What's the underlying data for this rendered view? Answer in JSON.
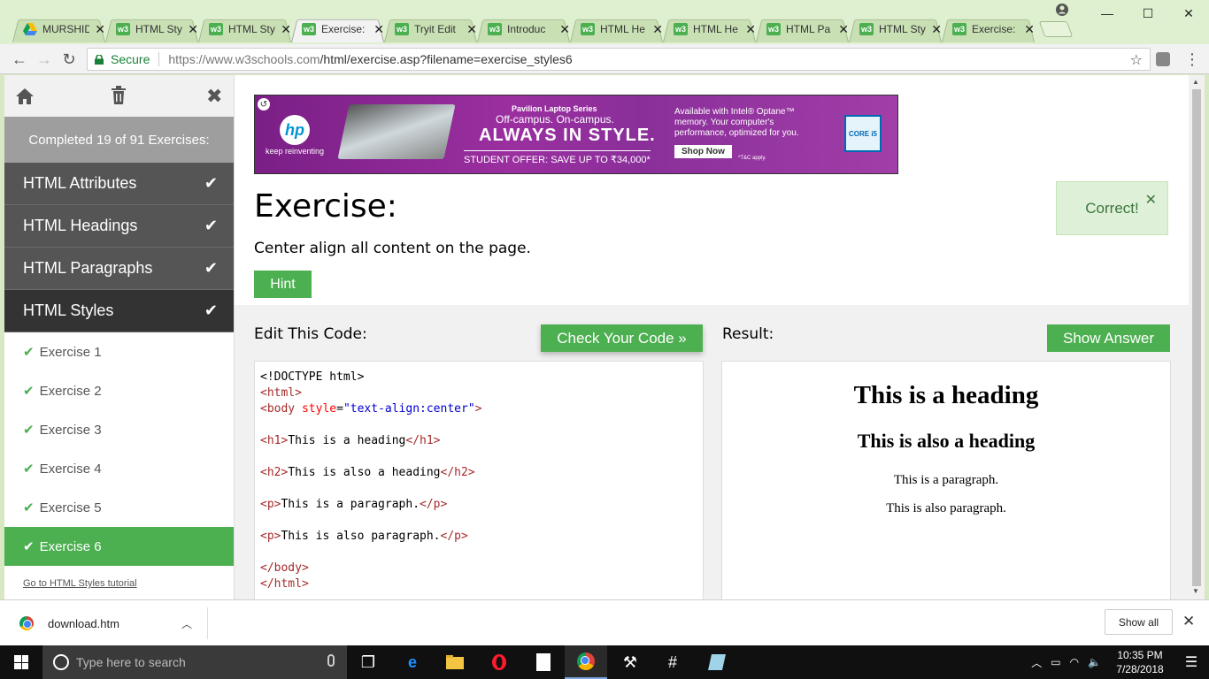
{
  "browser": {
    "tabs": [
      {
        "title": "MURSHID",
        "icon": "drive-icon",
        "active": false
      },
      {
        "title": "HTML Sty",
        "icon": "w3-icon",
        "active": false
      },
      {
        "title": "HTML Sty",
        "icon": "w3-icon",
        "active": false
      },
      {
        "title": "Exercise:",
        "icon": "w3-icon",
        "active": true
      },
      {
        "title": "Tryit Edit",
        "icon": "w3-icon",
        "active": false
      },
      {
        "title": "Introduc",
        "icon": "w3-icon",
        "active": false
      },
      {
        "title": "HTML He",
        "icon": "w3-icon",
        "active": false
      },
      {
        "title": "HTML He",
        "icon": "w3-icon",
        "active": false
      },
      {
        "title": "HTML Pa",
        "icon": "w3-icon",
        "active": false
      },
      {
        "title": "HTML Sty",
        "icon": "w3-icon",
        "active": false
      },
      {
        "title": "Exercise:",
        "icon": "w3-icon",
        "active": false
      }
    ],
    "favicon_label": "w3",
    "secure_label": "Secure",
    "url_host": "https://www.w3schools.com",
    "url_path": "/html/exercise.asp?filename=exercise_styles6"
  },
  "sidebar": {
    "progress": "Completed 19 of 91 Exercises:",
    "topics": [
      {
        "label": "HTML Attributes",
        "done": true
      },
      {
        "label": "HTML Headings",
        "done": true
      },
      {
        "label": "HTML Paragraphs",
        "done": true
      },
      {
        "label": "HTML Styles",
        "done": true
      }
    ],
    "exercises": [
      "Exercise 1",
      "Exercise 2",
      "Exercise 3",
      "Exercise 4",
      "Exercise 5",
      "Exercise 6"
    ],
    "active_exercise": 5,
    "tutorial_link": "Go to HTML Styles tutorial"
  },
  "ad": {
    "brand": "hp",
    "tagline": "keep reinventing",
    "series": "Pavilion Laptop Series",
    "line1": "Off-campus. On-campus.",
    "headline": "ALWAYS IN STYLE.",
    "offer": "STUDENT OFFER: SAVE UP TO ₹34,000*",
    "right_text": "Available with Intel® Optane™ memory. Your computer's performance, optimized for you.",
    "cta": "Shop Now",
    "terms": "*T&C apply.",
    "badge": "CORE i5"
  },
  "exercise": {
    "title": "Exercise:",
    "instruction": "Center align all content on the page.",
    "hint_label": "Hint",
    "correct_label": "Correct!",
    "edit_label": "Edit This Code:",
    "check_label": "Check Your Code »",
    "result_label": "Result:",
    "show_answer_label": "Show Answer"
  },
  "code": {
    "doctype": "<!DOCTYPE html>",
    "html_open": "<html>",
    "body_open_tag": "<body",
    "body_attr": "style",
    "body_val": "\"text-align:center\"",
    "h1_open": "<h1>",
    "h1_text": "This is a heading",
    "h1_close": "</h1>",
    "h2_open": "<h2>",
    "h2_text": "This is also a heading",
    "h2_close": "</h2>",
    "p_open": "<p>",
    "p1_text": "This is a paragraph.",
    "p_close": "</p>",
    "p2_text": "This is also paragraph.",
    "body_close": "</body>",
    "html_close": "</html>"
  },
  "result": {
    "h1": "This is a heading",
    "h2": "This is also a heading",
    "p1": "This is a paragraph.",
    "p2": "This is also paragraph."
  },
  "downloads": {
    "file": "download.htm",
    "show_all": "Show all"
  },
  "taskbar": {
    "search_placeholder": "Type here to search",
    "time": "10:35 PM",
    "date": "7/28/2018"
  },
  "colors": {
    "w3_green": "#4caf50",
    "sidebar_dark": "#555555",
    "correct_bg": "#dff0d8",
    "tab_strip": "#dff0d0"
  }
}
